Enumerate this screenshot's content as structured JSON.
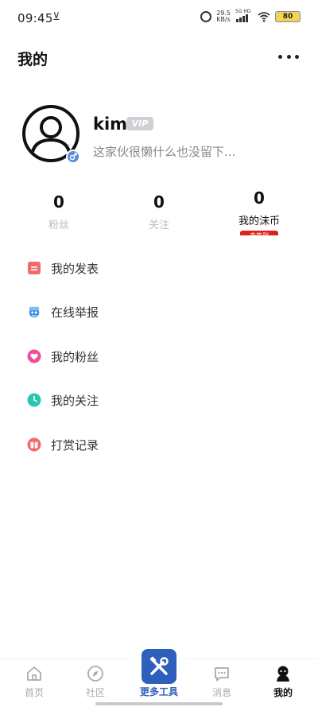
{
  "status_bar": {
    "time": "09:45",
    "download_indicator": "⊻",
    "net_speed_value": "29.5",
    "net_speed_unit": "KB/s",
    "signal_label": "5G HD",
    "battery": "80"
  },
  "header": {
    "title": "我的"
  },
  "profile": {
    "username": "kim",
    "vip_badge": "VIP",
    "bio": "这家伙很懒什么也没留下..."
  },
  "stats": [
    {
      "value": "0",
      "label": "粉丝"
    },
    {
      "value": "0",
      "label": "关注"
    },
    {
      "value": "0",
      "label": "我的沫币",
      "tag": "去签到"
    }
  ],
  "menu": [
    {
      "label": "我的发表",
      "icon": "post-icon",
      "color": "#f26a6a"
    },
    {
      "label": "在线举报",
      "icon": "report-mascot-icon",
      "color": "#3d8fe0"
    },
    {
      "label": "我的粉丝",
      "icon": "heart-icon",
      "color": "#ee4f9c"
    },
    {
      "label": "我的关注",
      "icon": "clock-icon",
      "color": "#2cc4b2"
    },
    {
      "label": "打赏记录",
      "icon": "gift-icon",
      "color": "#f26a6a"
    }
  ],
  "bottom_nav": {
    "home": "首页",
    "community": "社区",
    "tools": "更多工具",
    "messages": "消息",
    "mine": "我的"
  }
}
